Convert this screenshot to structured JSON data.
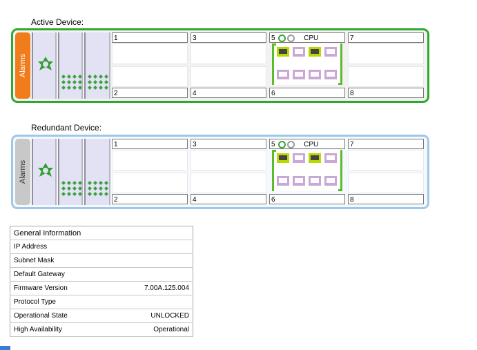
{
  "active": {
    "title": "Active Device:",
    "alarms_label": "Alarms",
    "slots": {
      "s1": "1",
      "s2": "2",
      "s3": "3",
      "s4": "4",
      "s5": "5",
      "s6": "6",
      "s7": "7",
      "s8": "8"
    },
    "cpu_label": "CPU"
  },
  "redundant": {
    "title": "Redundant Device:",
    "alarms_label": "Alarms",
    "slots": {
      "s1": "1",
      "s2": "2",
      "s3": "3",
      "s4": "4",
      "s5": "5",
      "s6": "6",
      "s7": "7",
      "s8": "8"
    },
    "cpu_label": "CPU"
  },
  "general_info": {
    "header": "General Information",
    "rows": [
      {
        "label": "IP Address",
        "value": ""
      },
      {
        "label": "Subnet Mask",
        "value": ""
      },
      {
        "label": "Default Gateway",
        "value": ""
      },
      {
        "label": "Firmware Version",
        "value": "7.00A.125.004"
      },
      {
        "label": "Protocol Type",
        "value": ""
      },
      {
        "label": "Operational State",
        "value": "UNLOCKED"
      },
      {
        "label": "High Availability",
        "value": "Operational"
      }
    ]
  },
  "colors": {
    "active_border": "#2ea82e",
    "redundant_border": "#9ec8ea",
    "alarm_active": "#f07c1c",
    "port_active": "#b8d800",
    "port_idle": "#c9a8d8"
  }
}
